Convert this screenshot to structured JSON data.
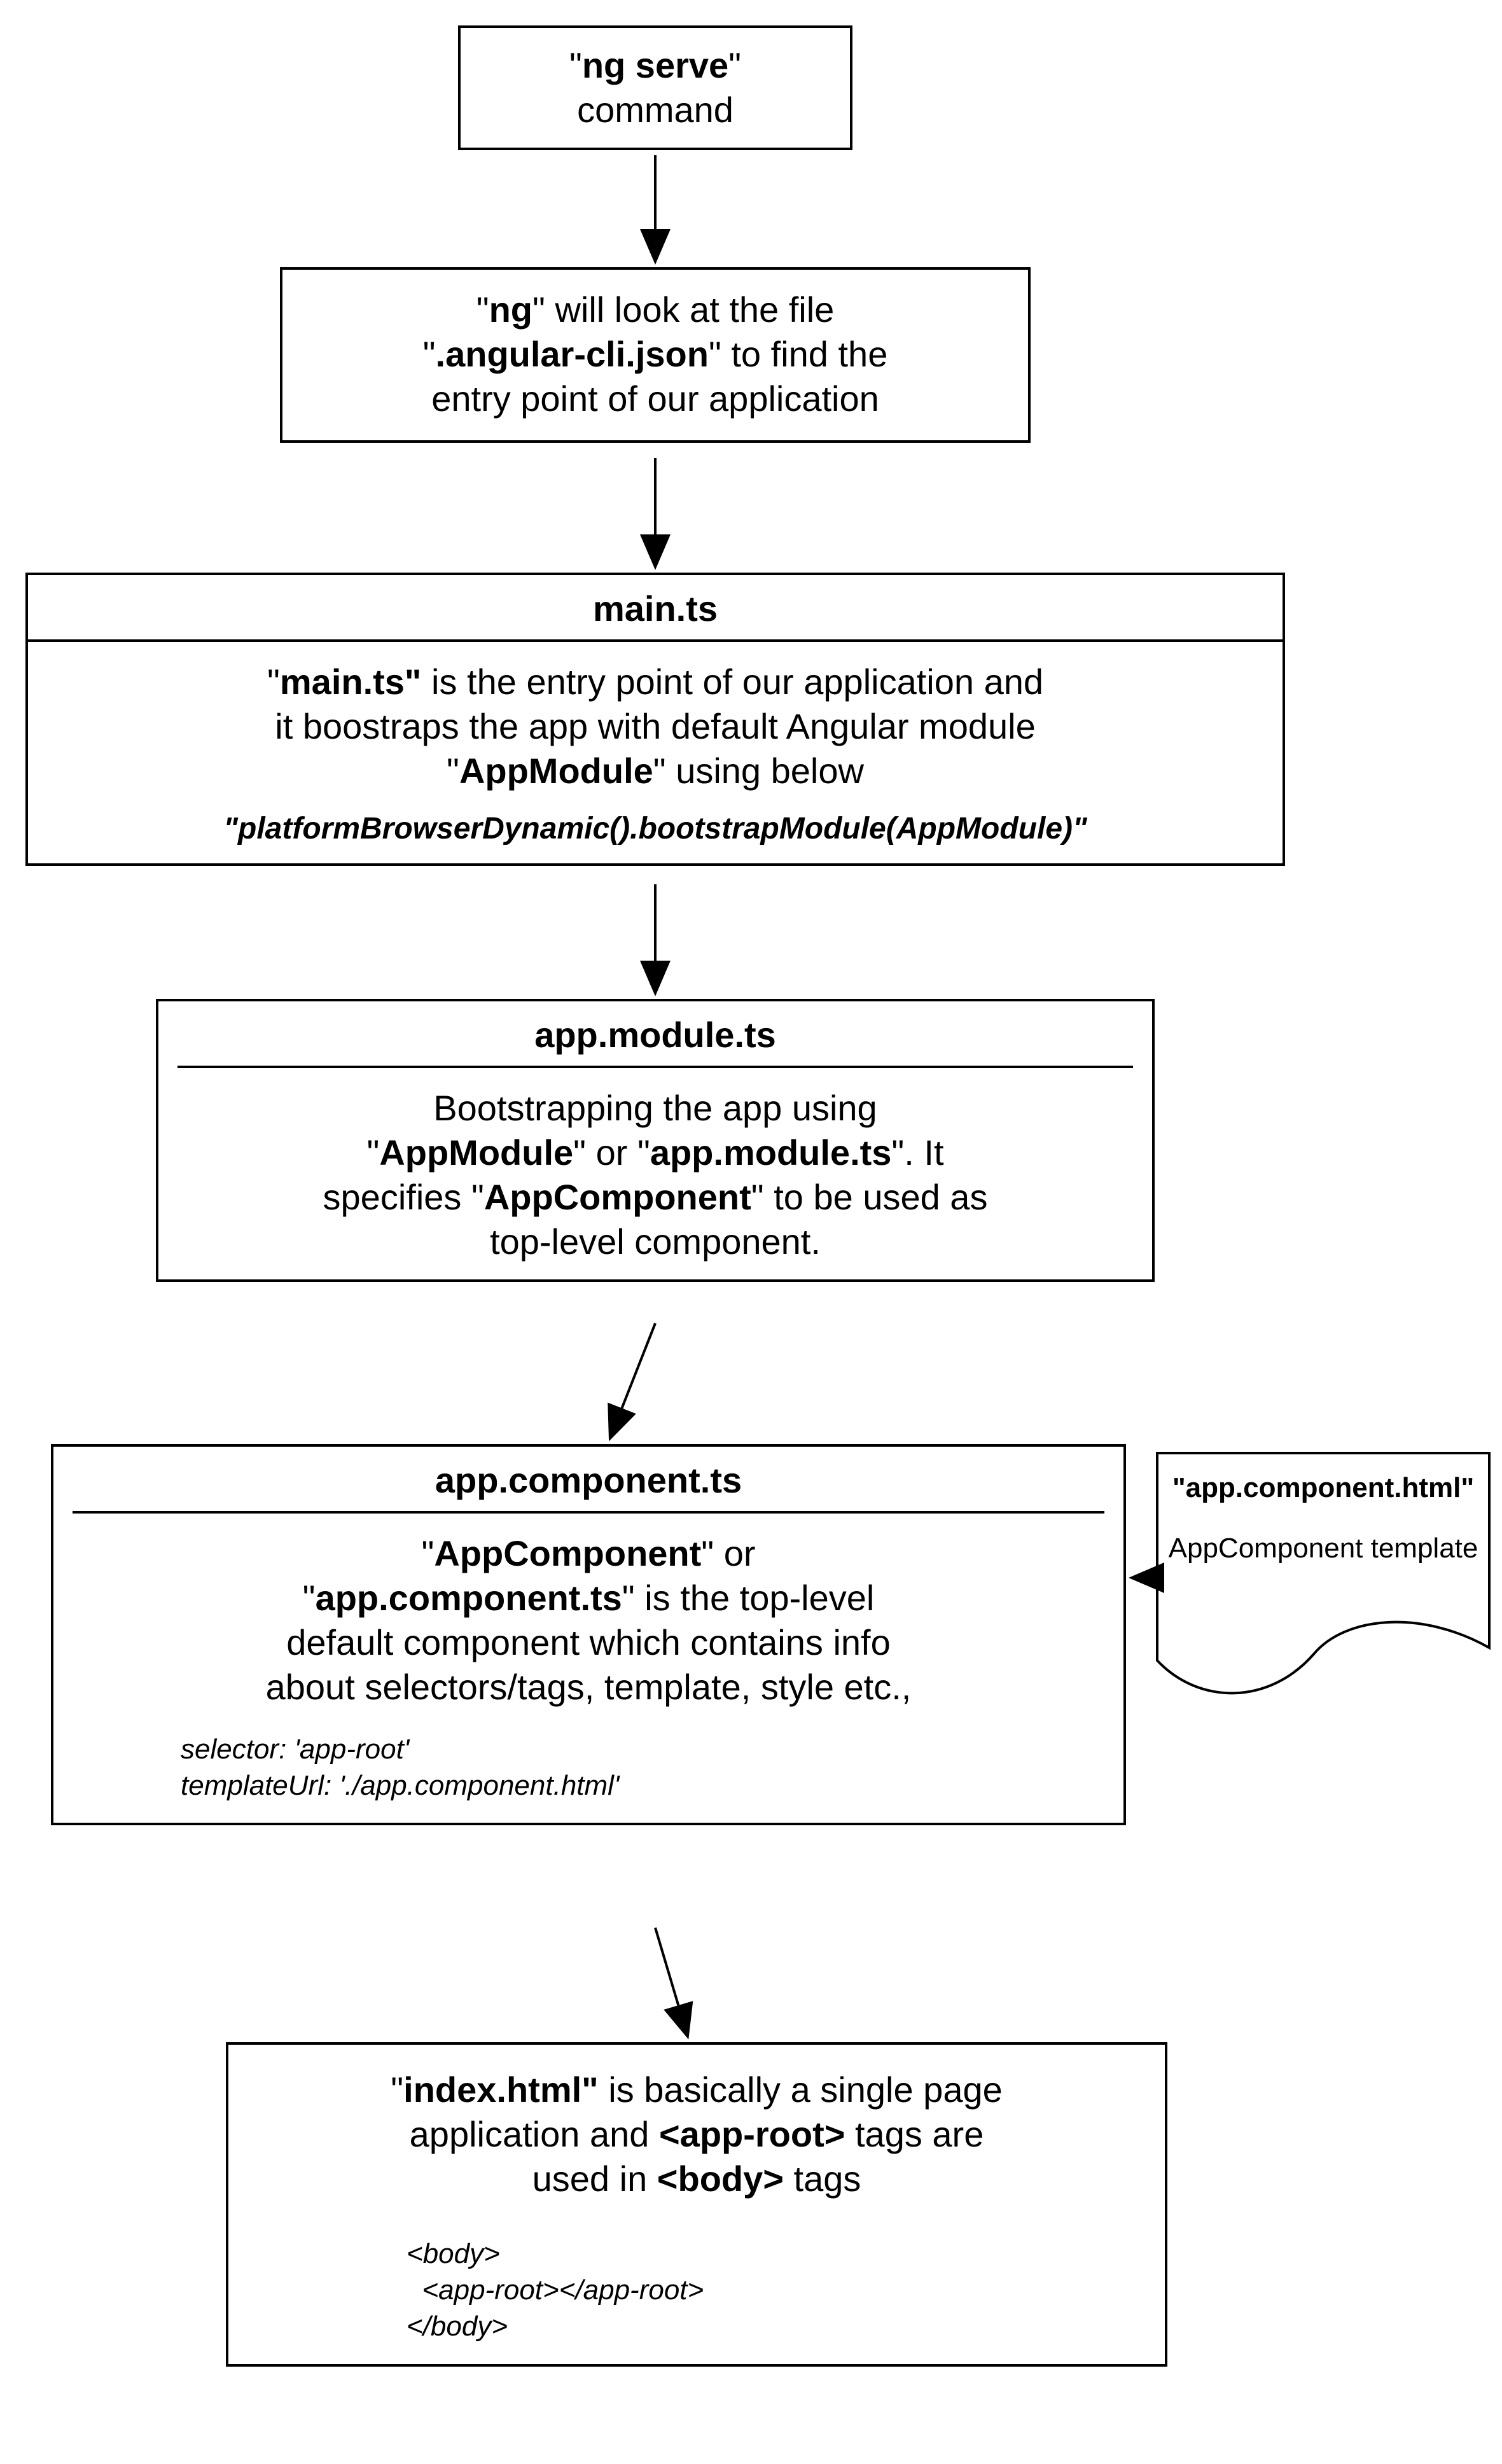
{
  "n1": {
    "line1_pre": "\"",
    "line1_b": "ng serve",
    "line1_post": "\"",
    "line2": "command"
  },
  "n2": {
    "pre1": "\"",
    "b1": "ng",
    "mid1": "\" will look at the file",
    "pre2": "\"",
    "b2": ".angular-cli.json",
    "mid2": "\" to find the",
    "line3": "entry point of our application"
  },
  "n3": {
    "title": "main.ts",
    "l1_pre": "\"",
    "l1_b": "main.ts\"",
    "l1_post": " is the entry point of our application and",
    "l2": "it boostraps the app with default Angular module",
    "l3_pre": "\"",
    "l3_b": "AppModule",
    "l3_post": "\" using below",
    "code": "\"platformBrowserDynamic().bootstrapModule(AppModule)\""
  },
  "n4": {
    "title": "app.module.ts",
    "l1": "Bootstrapping the app using",
    "l2_pre": "\"",
    "l2_b1": "AppModule",
    "l2_mid": "\" or \"",
    "l2_b2": "app.module.ts",
    "l2_post": "\". It",
    "l3_pre": "specifies \"",
    "l3_b": "AppComponent",
    "l3_post": "\" to be used as",
    "l4": "top-level component."
  },
  "n5": {
    "title": "app.component.ts",
    "l1_pre": "\"",
    "l1_b1": "AppComponent",
    "l1_mid": "\" or",
    "l2_pre": "\"",
    "l2_b": "app.component.ts",
    "l2_post": "\" is the top-level",
    "l3": "default component which contains info",
    "l4": "about selectors/tags, template, style etc.,",
    "code1": "selector: 'app-root'",
    "code2": "templateUrl: './app.component.html'"
  },
  "doc": {
    "title": "\"app.component.html\"",
    "sub": "AppComponent template"
  },
  "n6": {
    "l1_pre": "\"",
    "l1_b": "index.html\"",
    "l1_post": " is basically a single page",
    "l2_pre": "application and ",
    "l2_b": "<app-root>",
    "l2_post": " tags are",
    "l3_pre": "used in ",
    "l3_b": "<body>",
    "l3_post": " tags",
    "code1": "<body>",
    "code2": "  <app-root></app-root>",
    "code3": "</body>"
  }
}
